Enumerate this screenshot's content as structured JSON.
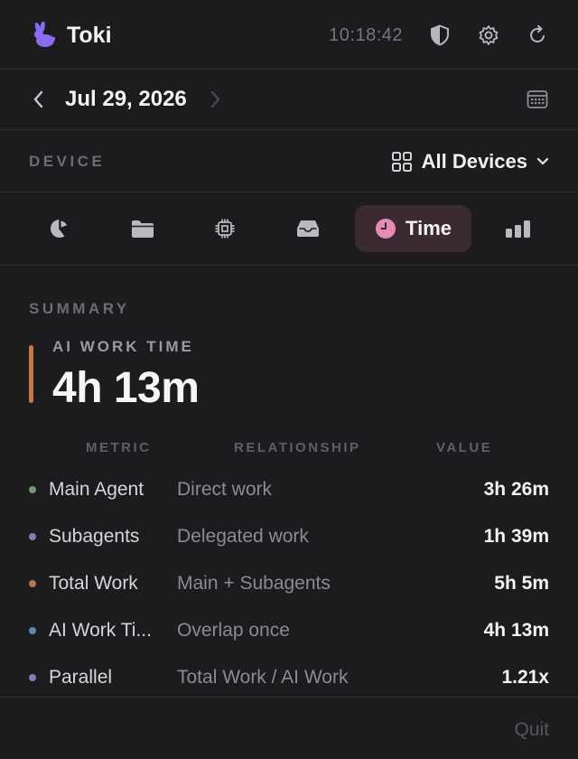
{
  "app": {
    "title": "Toki",
    "clock": "10:18:42"
  },
  "date_nav": {
    "date": "Jul 29, 2026"
  },
  "device": {
    "label": "DEVICE",
    "selected": "All Devices"
  },
  "tabs": [
    {
      "icon": "pie-chart-icon",
      "label": ""
    },
    {
      "icon": "folder-icon",
      "label": ""
    },
    {
      "icon": "cpu-chip-icon",
      "label": ""
    },
    {
      "icon": "inbox-tray-icon",
      "label": ""
    },
    {
      "icon": "clock-icon",
      "label": "Time",
      "active": true
    },
    {
      "icon": "bar-chart-icon",
      "label": ""
    }
  ],
  "summary": {
    "section_label": "SUMMARY",
    "headline_label": "AI WORK TIME",
    "headline_value": "4h 13m",
    "accent_color": "#c8764a"
  },
  "table": {
    "headers": {
      "metric": "METRIC",
      "relationship": "RELATIONSHIP",
      "value": "VALUE"
    },
    "rows": [
      {
        "metric": "Main Agent",
        "relationship": "Direct work",
        "value": "3h 26m",
        "dot_color": "#6f9a6e"
      },
      {
        "metric": "Subagents",
        "relationship": "Delegated work",
        "value": "1h 39m",
        "dot_color": "#8f79b3"
      },
      {
        "metric": "Total Work",
        "relationship": "Main + Subagents",
        "value": "5h 5m",
        "dot_color": "#b77452"
      },
      {
        "metric": "AI Work Ti...",
        "relationship": "Overlap once",
        "value": "4h 13m",
        "dot_color": "#5f86ad"
      },
      {
        "metric": "Parallel",
        "relationship": "Total Work / AI Work",
        "value": "1.21x",
        "dot_color": "#8a78b6"
      }
    ]
  },
  "footer": {
    "quit_label": "Quit"
  },
  "colors": {
    "background": "#1c1c1f",
    "active_tab": "#3c2a33",
    "brand": "#8b6cf0",
    "clock_icon": "#e58cb4"
  }
}
